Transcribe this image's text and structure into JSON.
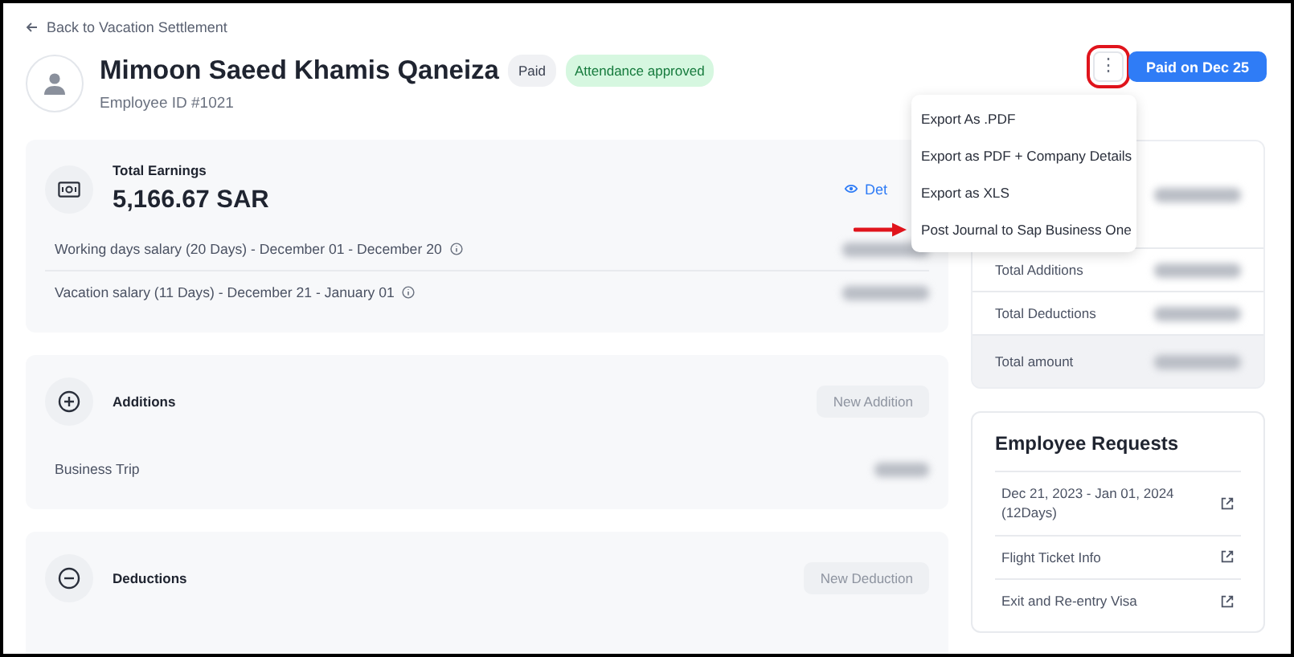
{
  "back_link": {
    "label": "Back to Vacation Settlement"
  },
  "employee": {
    "name": "Mimoon Saeed Khamis Qaneiza",
    "id_label": "Employee ID #1021",
    "badges": [
      {
        "label": "Paid",
        "kind": "neutral"
      },
      {
        "label": "Attendance approved",
        "kind": "success"
      }
    ]
  },
  "actions": {
    "more_button": {
      "label": "⋮",
      "highlighted": true
    },
    "primary_button": {
      "label": "Paid on Dec 25"
    }
  },
  "menu": {
    "items": [
      {
        "label": "Export As .PDF",
        "pointed": false
      },
      {
        "label": "Export as PDF + Company Details",
        "pointed": false
      },
      {
        "label": "Export as XLS",
        "pointed": false
      },
      {
        "label": "Post Journal to Sap Business One",
        "pointed": true
      }
    ]
  },
  "earnings": {
    "title": "Total Earnings",
    "amount": "5,166.67 SAR",
    "details_link": "Det",
    "rows": [
      {
        "label": "Working days salary (20 Days) - December 01 - December 20"
      },
      {
        "label": "Vacation salary (11 Days) - December 21 - January 01"
      }
    ]
  },
  "sections": [
    {
      "kind": "additions",
      "title": "Additions",
      "button": {
        "label": "New Addition",
        "disabled": true
      },
      "rows": [
        {
          "label": "Business Trip"
        }
      ]
    },
    {
      "kind": "deductions",
      "title": "Deductions",
      "button": {
        "label": "New Deduction",
        "disabled": true
      }
    }
  ],
  "summary": {
    "rows": [
      {
        "label": "Total Additions",
        "kind": "line"
      },
      {
        "label": "Total Deductions",
        "kind": "line"
      },
      {
        "label": "Total amount",
        "kind": "total"
      }
    ]
  },
  "requests": {
    "title": "Employee Requests",
    "items": [
      {
        "label": "Dec 21, 2023 - Jan 01, 2024 (12Days)"
      },
      {
        "label": "Flight Ticket Info"
      },
      {
        "label": "Exit and Re-entry Visa"
      }
    ]
  }
}
